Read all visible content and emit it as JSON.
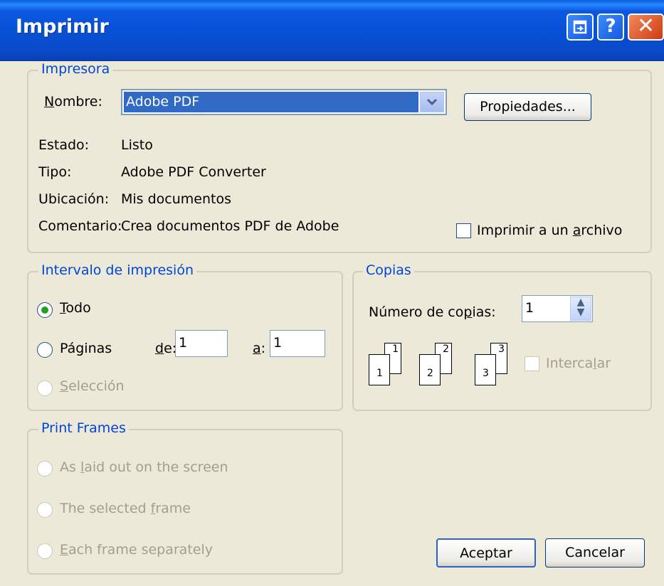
{
  "window": {
    "title": "Imprimir"
  },
  "printer": {
    "legend": "Impresora",
    "name_label": "Nombre:",
    "name_value": "Adobe PDF",
    "properties_button": "Propiedades...",
    "status_label": "Estado:",
    "status_value": "Listo",
    "type_label": "Tipo:",
    "type_value": "Adobe PDF Converter",
    "location_label": "Ubicación:",
    "location_value": "Mis documentos",
    "comment_label": "Comentario:",
    "comment_value": "Crea documentos PDF de Adobe",
    "print_to_file": "Imprimir a un archivo"
  },
  "range": {
    "legend": "Intervalo de impresión",
    "all": "Todo",
    "pages": "Páginas",
    "from_label": "de:",
    "from_value": "1",
    "to_label": "a:",
    "to_value": "1",
    "selection": "Selección"
  },
  "copies": {
    "legend": "Copias",
    "count_label": "Número de copias:",
    "count_value": "1",
    "collate": "Intercalar",
    "collate_pages": [
      "1",
      "1",
      "2",
      "2",
      "3",
      "3"
    ]
  },
  "frames": {
    "legend": "Print Frames",
    "option1": "As laid out on the screen",
    "option2": "The selected frame",
    "option3": "Each frame separately"
  },
  "buttons": {
    "ok": "Aceptar",
    "cancel": "Cancelar"
  },
  "icons": {
    "restore": "restore-icon",
    "help": "help-icon",
    "close": "close-icon",
    "dropdown": "chevron-down-icon",
    "spinner": "spinner-arrows-icon"
  }
}
